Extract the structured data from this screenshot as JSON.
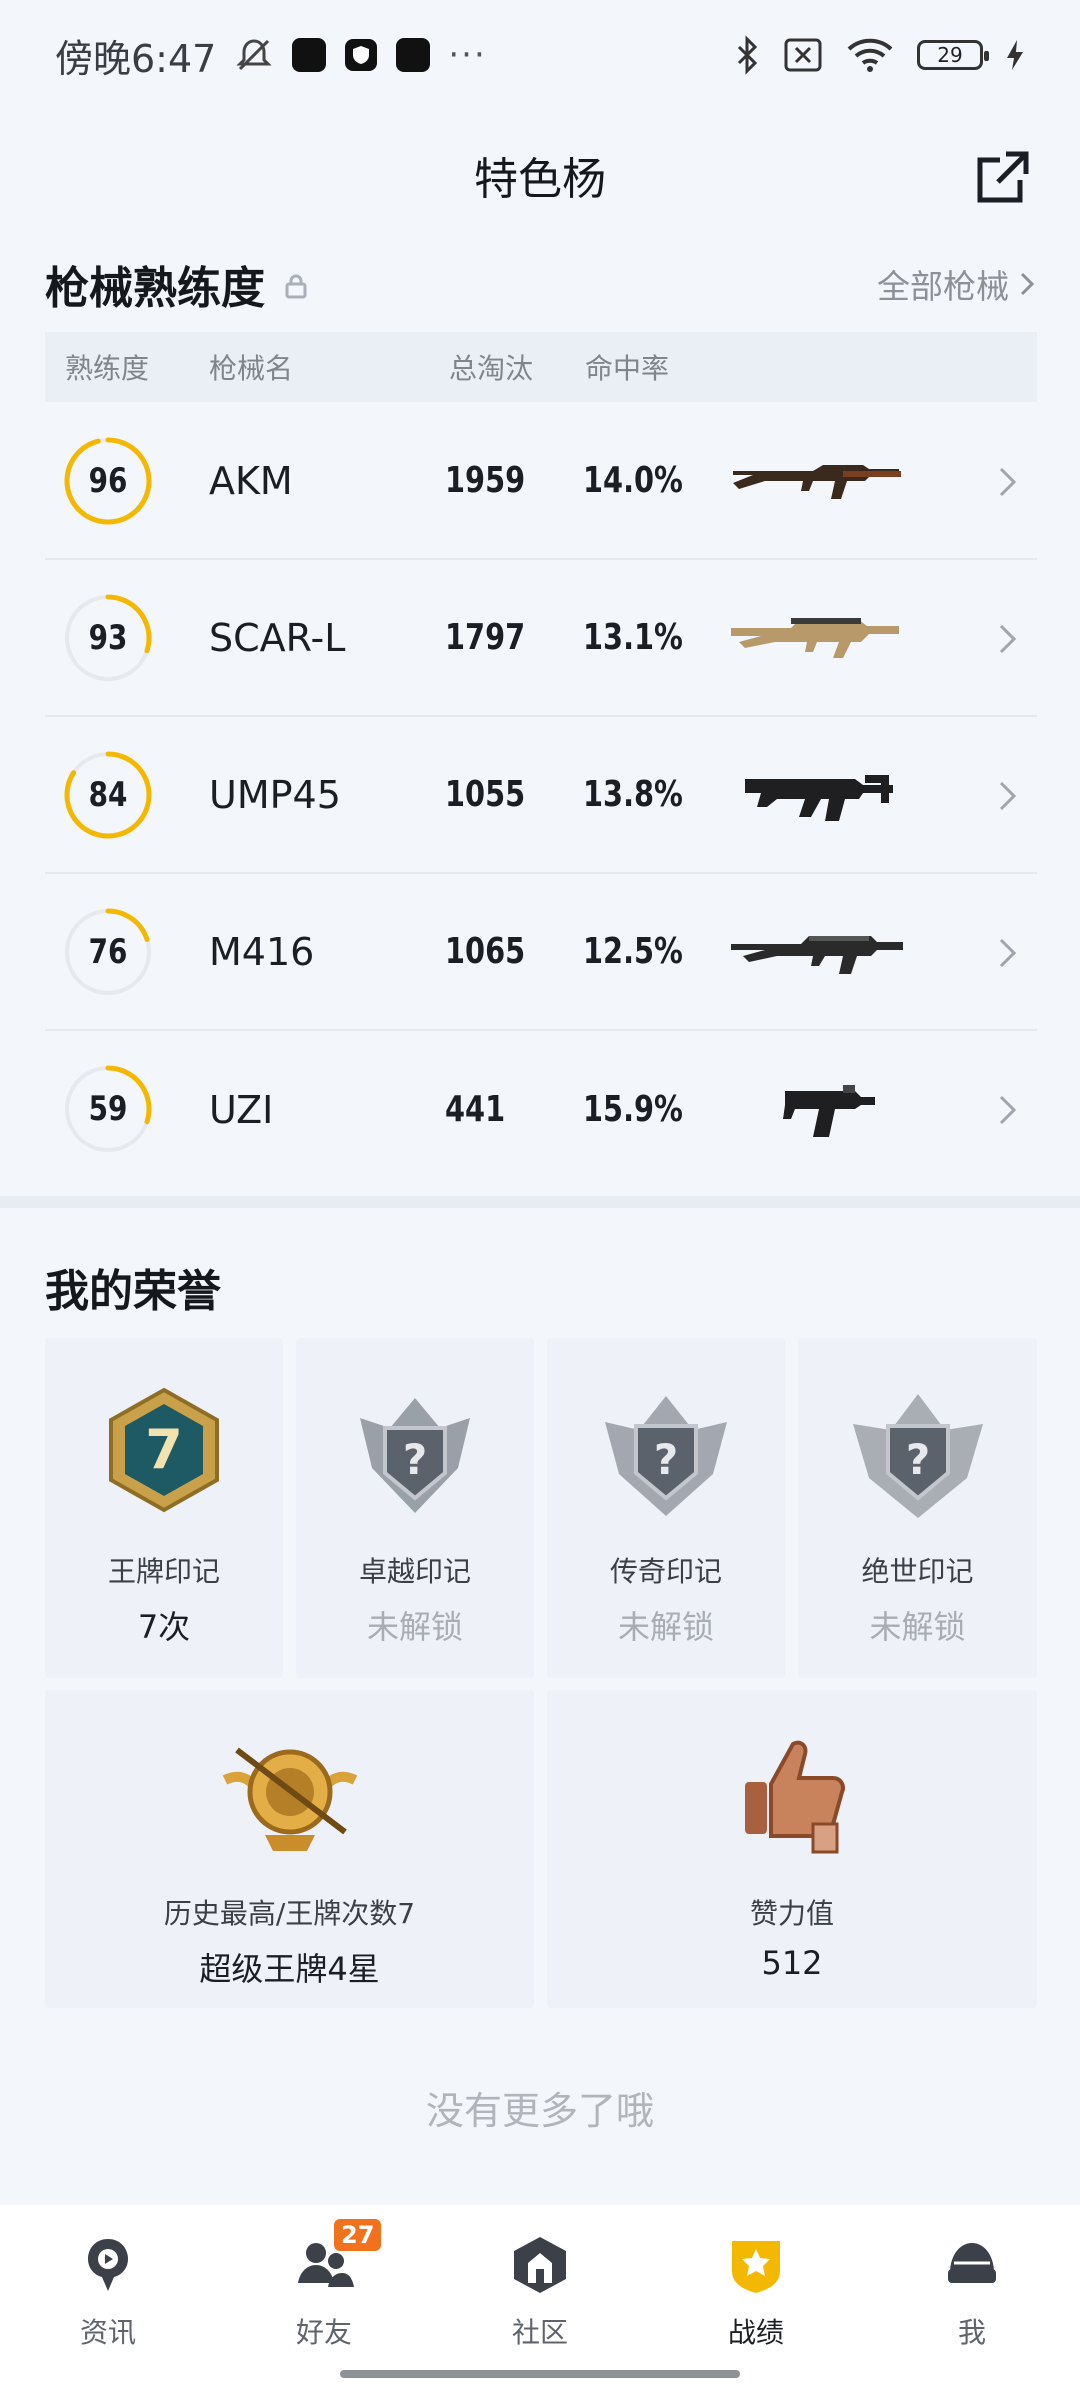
{
  "status_bar": {
    "time": "傍晚6:47",
    "dots": "···",
    "battery": "29"
  },
  "header": {
    "title": "特色杨"
  },
  "weapons": {
    "title": "枪械熟练度",
    "all_link": "全部枪械",
    "columns": [
      "熟练度",
      "枪械名",
      "总淘汰",
      "命中率"
    ],
    "items": [
      {
        "proficiency": "96",
        "level": 0.96,
        "name": "AKM",
        "kills": "1959",
        "rate": "14.0%",
        "icon": "akm-rifle"
      },
      {
        "proficiency": "93",
        "level": 0.3,
        "name": "SCAR-L",
        "kills": "1797",
        "rate": "13.1%",
        "icon": "scar-rifle"
      },
      {
        "proficiency": "84",
        "level": 0.84,
        "name": "UMP45",
        "kills": "1055",
        "rate": "13.8%",
        "icon": "ump-smg"
      },
      {
        "proficiency": "76",
        "level": 0.2,
        "name": "M416",
        "kills": "1065",
        "rate": "12.5%",
        "icon": "m416-rifle"
      },
      {
        "proficiency": "59",
        "level": 0.3,
        "name": "UZI",
        "kills": "441",
        "rate": "15.9%",
        "icon": "uzi-smg"
      }
    ]
  },
  "honors": {
    "title": "我的荣誉",
    "marks": [
      {
        "label": "王牌印记",
        "value": "7次",
        "badge_text": "7",
        "locked": false
      },
      {
        "label": "卓越印记",
        "value": "未解锁",
        "badge_text": "?",
        "locked": true
      },
      {
        "label": "传奇印记",
        "value": "未解锁",
        "badge_text": "?",
        "locked": true
      },
      {
        "label": "绝世印记",
        "value": "未解锁",
        "badge_text": "?",
        "locked": true
      }
    ],
    "highest": {
      "label": "历史最高/王牌次数7",
      "value": "超级王牌4星"
    },
    "likes": {
      "label": "赞力值",
      "value": "512"
    }
  },
  "footer_text": "没有更多了哦",
  "nav": {
    "items": [
      {
        "label": "资讯",
        "icon": "news-icon"
      },
      {
        "label": "好友",
        "icon": "friends-icon",
        "badge": "27"
      },
      {
        "label": "社区",
        "icon": "community-icon"
      },
      {
        "label": "战绩",
        "icon": "stats-icon",
        "active": true
      },
      {
        "label": "我",
        "icon": "me-icon"
      }
    ]
  },
  "colors": {
    "accent": "#f5b800",
    "ring_track": "#e6e9ee",
    "badge_orange": "#f2711c"
  }
}
